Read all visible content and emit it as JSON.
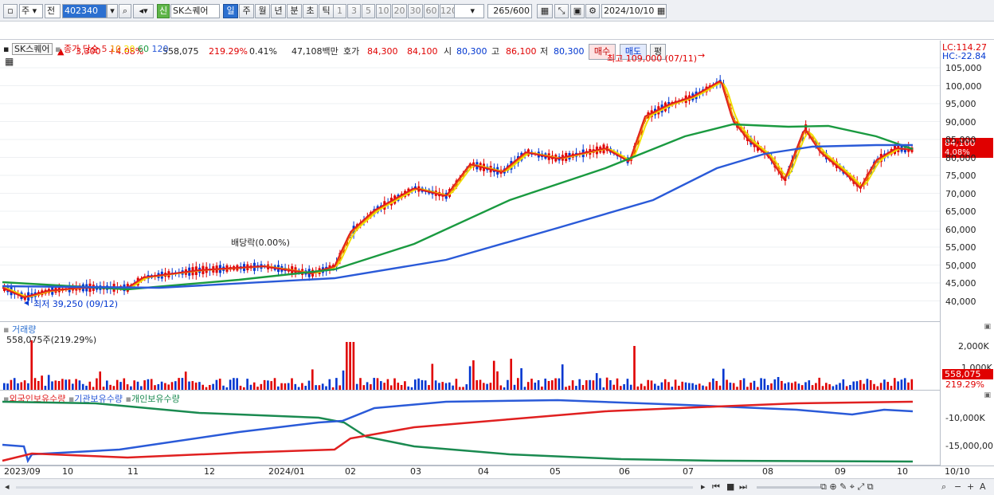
{
  "toolbar": {
    "market": "주",
    "market_opt": "전",
    "code": "402340",
    "news_tag": "신",
    "name": "SK스퀘어",
    "periods": [
      "일",
      "주",
      "월",
      "년",
      "분",
      "초",
      "틱"
    ],
    "active_period": "일",
    "intervals": [
      "1",
      "3",
      "5",
      "10",
      "20",
      "30",
      "60",
      "120"
    ],
    "count": "265",
    "count_total": "/600",
    "date": "2024/10/10"
  },
  "quote": {
    "price": "84,100",
    "change": "3,300",
    "change_pct": "+4.08%",
    "volume": "558,075",
    "volume_ratio": "219.29%",
    "turnover_rate": "0.41%",
    "value": "47,108백만",
    "ask_label": "호가",
    "ask1": "84,300",
    "ask2": "84,100",
    "open_label": "시",
    "open": "80,300",
    "high_label": "고",
    "high": "86,100",
    "low_label": "저",
    "low": "80,300",
    "buy_label": "매수",
    "sell_label": "매도",
    "eval_label": "평"
  },
  "price_panel": {
    "title": "SK스퀘어",
    "legend_prefix": "종가 단순",
    "ma": [
      {
        "period": "5",
        "color": "#e02020"
      },
      {
        "period": "10",
        "color": "#f08a00"
      },
      {
        "period": "20",
        "color": "#f0e000"
      },
      {
        "period": "60",
        "color": "#1a9a40"
      },
      {
        "period": "120",
        "color": "#2a5ad8"
      }
    ],
    "lc": "LC:114.27",
    "hc": "HC:-22.84",
    "high_note": "최고 109,000 (07/11)",
    "low_note": "최저 39,250 (09/12)",
    "dividend_note": "배당락(0.00%)",
    "current_price_tag": "84,100",
    "current_pct_tag": "4.08%",
    "y_ticks": [
      "105,000",
      "100,000",
      "95,000",
      "90,000",
      "85,000",
      "80,000",
      "75,000",
      "70,000",
      "65,000",
      "60,000",
      "55,000",
      "50,000",
      "45,000",
      "40,000"
    ]
  },
  "volume_panel": {
    "title": "거래량",
    "value": "558,075주(219.29%)",
    "y_ticks": [
      "2,000K",
      "1,000K"
    ],
    "tag_value": "558,075",
    "tag_pct": "219.29%"
  },
  "holding_panel": {
    "legend": [
      {
        "label": "외국인보유수량",
        "color": "#e02020"
      },
      {
        "label": "기관보유수량",
        "color": "#2a5ad8"
      },
      {
        "label": "개인보유수량",
        "color": "#1a8a50"
      }
    ],
    "y_ticks": [
      "-10,000K",
      "-15,000,00"
    ]
  },
  "x_axis": [
    "2023/09",
    "10",
    "11",
    "12",
    "2024/01",
    "02",
    "03",
    "04",
    "05",
    "06",
    "07",
    "08",
    "09",
    "10"
  ],
  "x_axis_right": "10/10",
  "colors": {
    "up": "#e00000",
    "down": "#0036d0",
    "accent": "#2b6fd0"
  }
}
